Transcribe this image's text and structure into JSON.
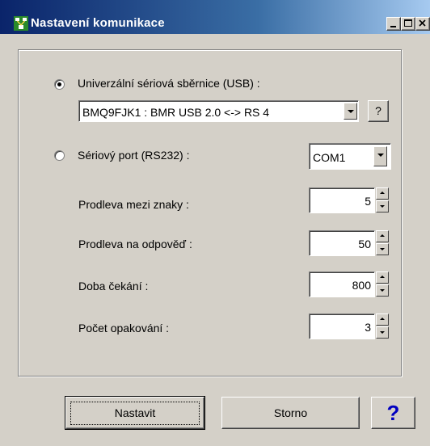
{
  "window": {
    "title": "Nastavení komunikace",
    "icon": "network-app-icon"
  },
  "titlebar_buttons": [
    "minimize-button",
    "maximize-button",
    "close-button"
  ],
  "usb": {
    "label": "Univerzální sériová sběrnice (USB) :",
    "selected": true,
    "device_value": "BMQ9FJK1 : BMR USB 2.0 <-> RS 4",
    "help_label": "?"
  },
  "serial": {
    "label": "Sériový port (RS232) :",
    "selected": false,
    "port_value": "COM1"
  },
  "fields": [
    {
      "label": "Prodleva mezi znaky :",
      "value": "5"
    },
    {
      "label": "Prodleva na odpověď :",
      "value": "50"
    },
    {
      "label": "Doba čekání :",
      "value": "800"
    },
    {
      "label": "Počet opakování :",
      "value": "3"
    }
  ],
  "buttons": {
    "ok": "Nastavit",
    "cancel": "Storno",
    "help": "?"
  },
  "colors": {
    "titlebar_start": "#0a246a",
    "titlebar_end": "#a6caf0",
    "face": "#d4d0c8",
    "help_blue": "#0000c0"
  }
}
